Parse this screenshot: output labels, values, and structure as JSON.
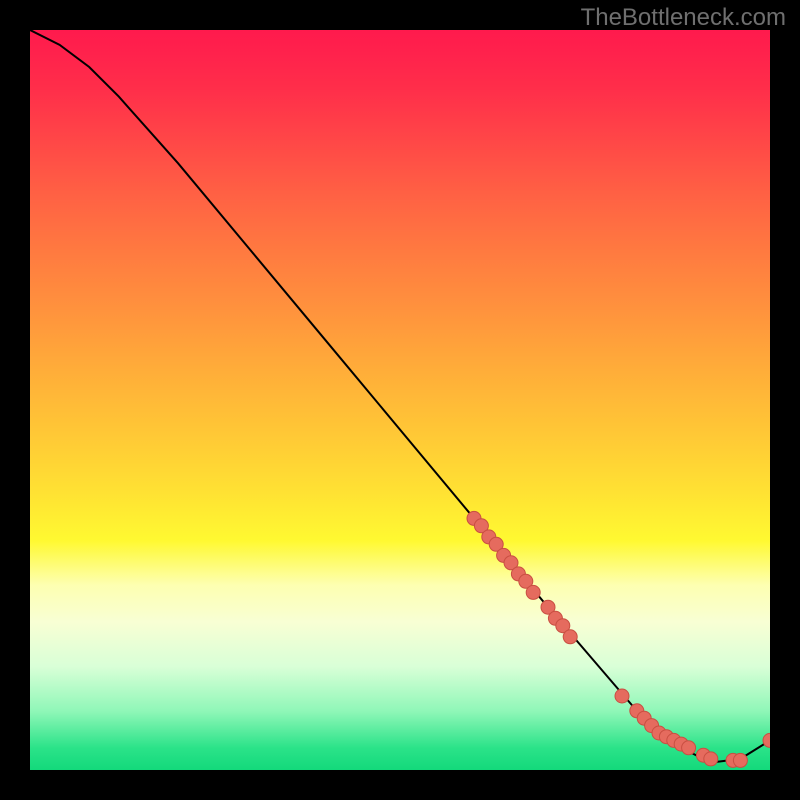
{
  "watermark": "TheBottleneck.com",
  "chart_data": {
    "type": "line",
    "title": "",
    "xlabel": "",
    "ylabel": "",
    "xlim": [
      0,
      100
    ],
    "ylim": [
      0,
      100
    ],
    "background_gradient": [
      "#ff1a4d",
      "#ff933d",
      "#fff931",
      "#13d97b"
    ],
    "series": [
      {
        "name": "bottleneck-curve",
        "x": [
          0,
          4,
          8,
          12,
          20,
          30,
          40,
          50,
          60,
          70,
          76,
          82,
          88,
          92,
          96,
          100
        ],
        "values": [
          100,
          98,
          95,
          91,
          82,
          70,
          58,
          46,
          34,
          22,
          15,
          8,
          3,
          1,
          1.5,
          4
        ]
      }
    ],
    "scatter_points": {
      "name": "bottleneck-dots",
      "x": [
        60,
        61,
        62,
        63,
        64,
        65,
        66,
        67,
        68,
        70,
        71,
        72,
        73,
        80,
        82,
        83,
        84,
        85,
        86,
        87,
        88,
        89,
        91,
        92,
        95,
        96,
        100
      ],
      "values": [
        34,
        33,
        31.5,
        30.5,
        29,
        28,
        26.5,
        25.5,
        24,
        22,
        20.5,
        19.5,
        18,
        10,
        8,
        7,
        6,
        5,
        4.5,
        4,
        3.5,
        3,
        2,
        1.5,
        1.3,
        1.3,
        4
      ]
    },
    "colors": {
      "curve": "#000000",
      "dot_fill": "#e56b5e",
      "dot_stroke": "#c94f42"
    }
  }
}
